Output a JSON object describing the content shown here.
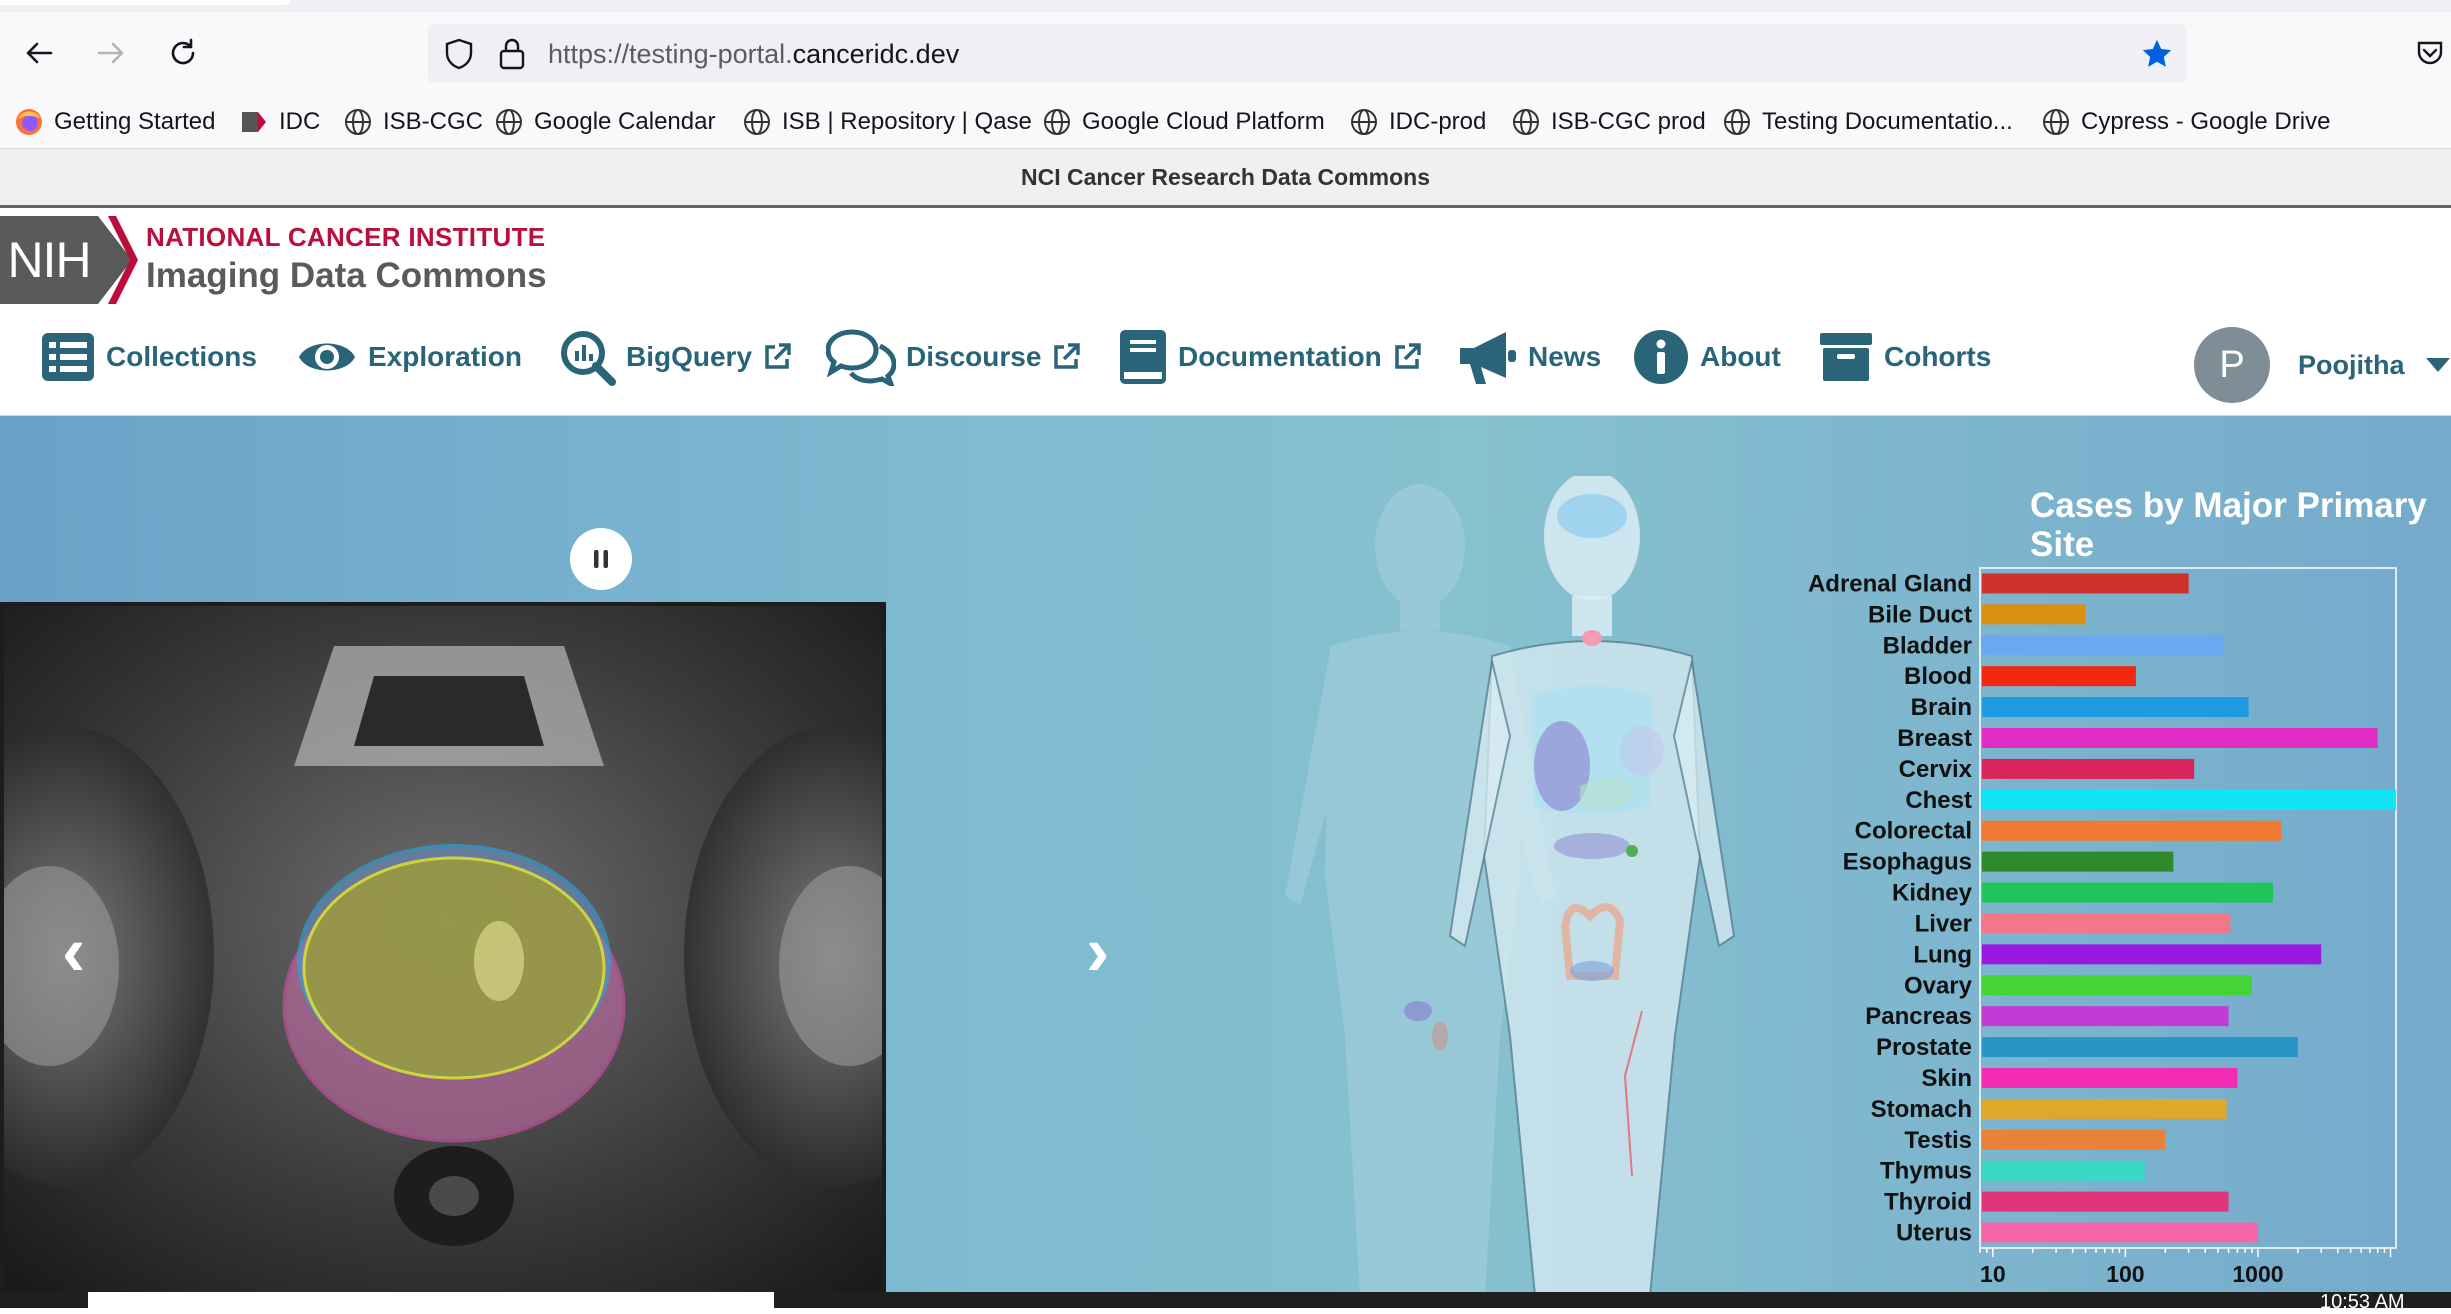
{
  "browser": {
    "url_prefix": "https://testing-portal.",
    "url_domain": "canceridc.dev",
    "bookmarks": [
      {
        "label": "Getting Started",
        "icon": "firefox-icon"
      },
      {
        "label": "IDC",
        "icon": "idc-icon"
      },
      {
        "label": "ISB-CGC",
        "icon": "globe-icon"
      },
      {
        "label": "Google Calendar",
        "icon": "globe-icon"
      },
      {
        "label": "ISB | Repository | Qase",
        "icon": "globe-icon"
      },
      {
        "label": "Google Cloud Platform",
        "icon": "globe-icon"
      },
      {
        "label": "IDC-prod",
        "icon": "globe-icon"
      },
      {
        "label": "ISB-CGC prod",
        "icon": "globe-icon"
      },
      {
        "label": "Testing Documentatio...",
        "icon": "globe-icon"
      },
      {
        "label": "Cypress - Google Drive",
        "icon": "globe-icon"
      }
    ]
  },
  "notice": "NCI Cancer Research Data Commons",
  "brand": {
    "nih": "NIH",
    "institute": "NATIONAL CANCER INSTITUTE",
    "product": "Imaging Data Commons"
  },
  "nav": {
    "collections": "Collections",
    "exploration": "Exploration",
    "bigquery": "BigQuery",
    "discourse": "Discourse",
    "documentation": "Documentation",
    "news": "News",
    "about": "About",
    "cohorts": "Cohorts",
    "user_initial": "P",
    "user_name": "Poojitha"
  },
  "carousel": {
    "prev": "‹",
    "next": "›"
  },
  "taskbar": {
    "clock": "10:53 AM"
  },
  "chart_data": {
    "type": "bar",
    "orientation": "horizontal",
    "title": "Cases by Major Primary Site",
    "x_scale": "log",
    "xlim": [
      8,
      11000
    ],
    "x_ticks": [
      "10",
      "100",
      "1000"
    ],
    "categories": [
      "Adrenal Gland",
      "Bile Duct",
      "Bladder",
      "Blood",
      "Brain",
      "Breast",
      "Cervix",
      "Chest",
      "Colorectal",
      "Esophagus",
      "Kidney",
      "Liver",
      "Lung",
      "Ovary",
      "Pancreas",
      "Prostate",
      "Skin",
      "Stomach",
      "Testis",
      "Thymus",
      "Thyroid",
      "Uterus"
    ],
    "values": [
      300,
      50,
      550,
      120,
      850,
      8000,
      330,
      11000,
      1500,
      230,
      1300,
      620,
      3000,
      900,
      600,
      2000,
      700,
      580,
      200,
      140,
      600,
      1000
    ],
    "colors": [
      "#d0312d",
      "#d9900e",
      "#6ba8f0",
      "#f2280f",
      "#1e9ae0",
      "#e02cc4",
      "#d9245c",
      "#0fe6f5",
      "#f07a32",
      "#2f8a2d",
      "#21c45a",
      "#f27788",
      "#9a18e0",
      "#44d436",
      "#c43ad4",
      "#2796c7",
      "#f22cb4",
      "#e0a82a",
      "#e88238",
      "#3ad9c4",
      "#e0357a",
      "#f565a8"
    ]
  }
}
